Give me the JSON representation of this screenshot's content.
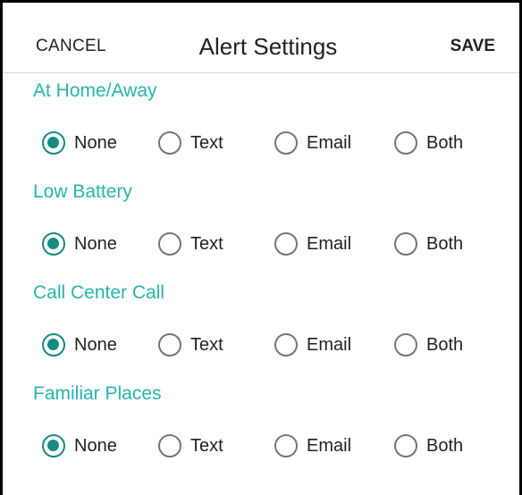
{
  "header": {
    "cancel_label": "CANCEL",
    "title": "Alert Settings",
    "save_label": "SAVE"
  },
  "options": [
    "None",
    "Text",
    "Email",
    "Both"
  ],
  "sections": [
    {
      "title": "At Home/Away",
      "selected": "None"
    },
    {
      "title": "Low Battery",
      "selected": "None"
    },
    {
      "title": "Call Center Call",
      "selected": "None"
    },
    {
      "title": "Familiar Places",
      "selected": "None"
    }
  ],
  "colors": {
    "accent": "#26b5ad",
    "radio_checked": "#178a84",
    "radio_unchecked": "#757575",
    "text": "#222222"
  }
}
